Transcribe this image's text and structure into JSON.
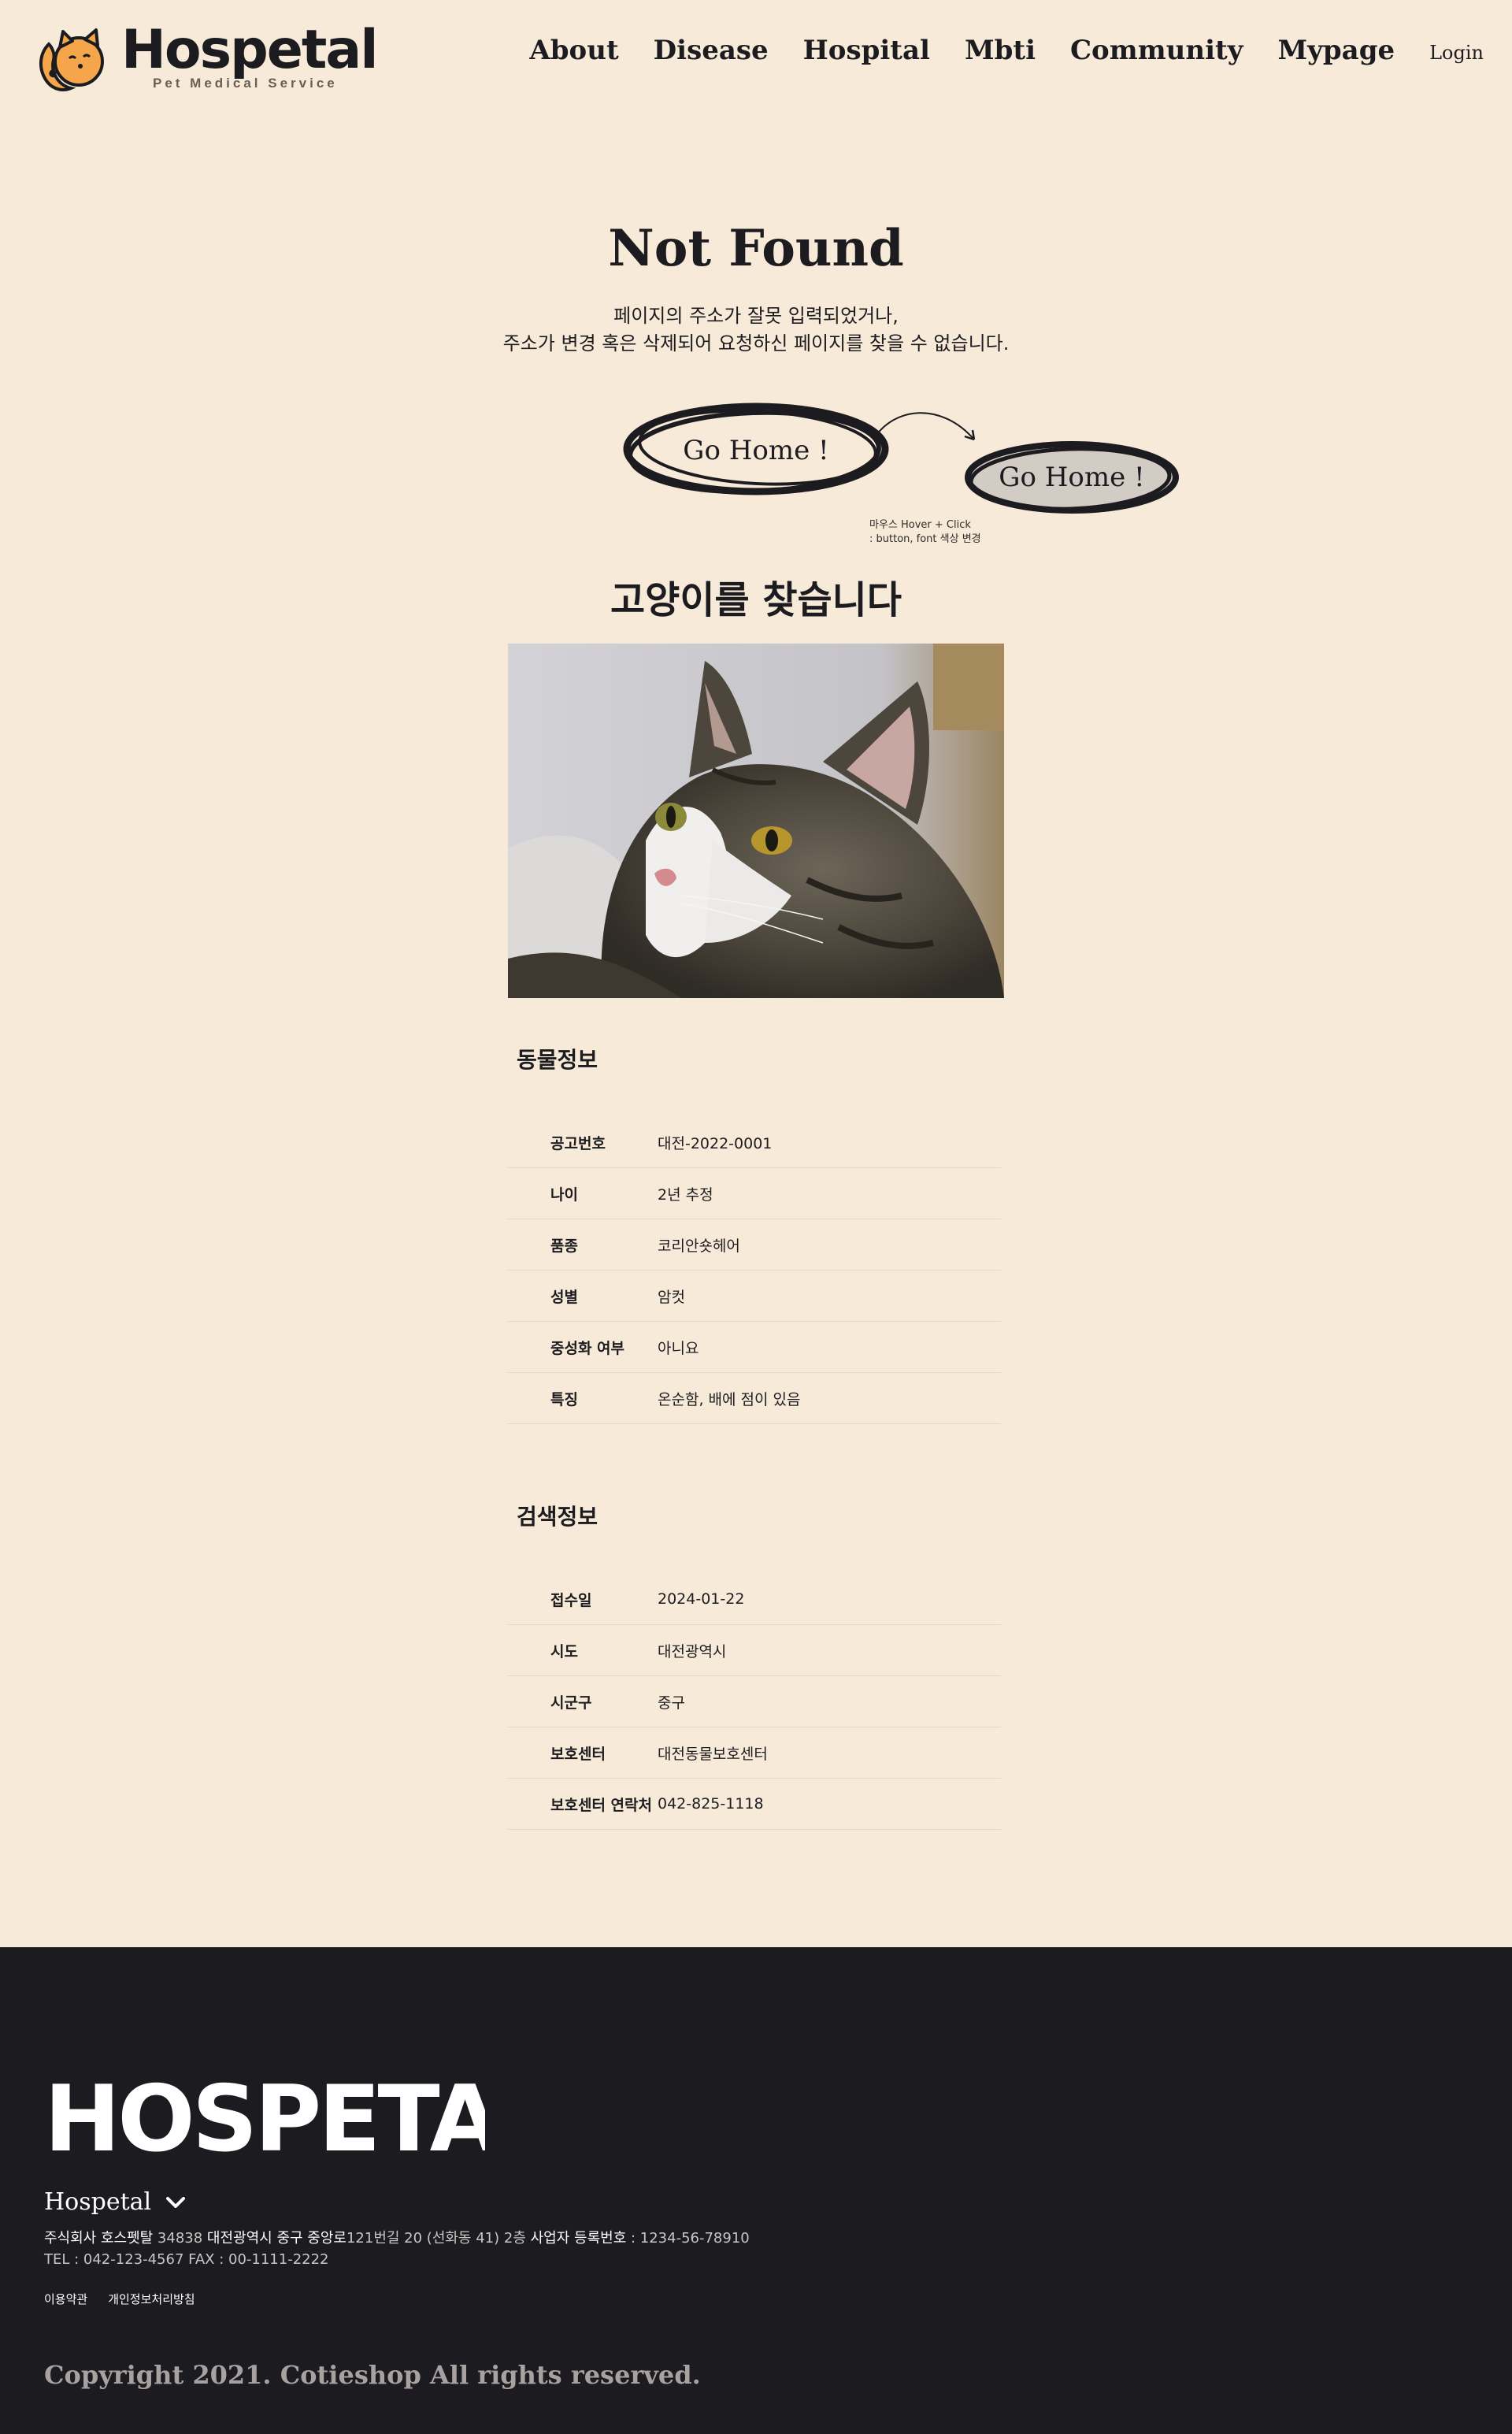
{
  "header": {
    "logo_text": "Hospetal",
    "logo_sub": "Pet Medical Service",
    "nav": [
      "About",
      "Disease",
      "Hospital",
      "Mbti",
      "Community",
      "Mypage"
    ],
    "login": "Login"
  },
  "not_found": {
    "title": "Not Found",
    "message_line1": "페이지의 주소가 잘못 입력되었거나,",
    "message_line2": "주소가 변경 혹은 삭제되어 요청하신 페이지를 찾을 수 없습니다.",
    "home_button": "Go Home !",
    "home_button_hover": "Go Home !",
    "hover_note_line1": "마우스 Hover + Click",
    "hover_note_line2": ": button, font 색상 변경"
  },
  "cat": {
    "title": "고양이를 찾습니다",
    "photo": "tabby-cat-photo"
  },
  "animal_info": {
    "title": "동물정보",
    "rows": [
      {
        "key": "공고번호",
        "value": "대전-2022-0001"
      },
      {
        "key": "나이",
        "value": "2년 추정"
      },
      {
        "key": "품종",
        "value": "코리안숏헤어"
      },
      {
        "key": "성별",
        "value": "암컷"
      },
      {
        "key": "중성화 여부",
        "value": "아니요"
      },
      {
        "key": "특징",
        "value": "온순함, 배에 점이 있음"
      }
    ]
  },
  "search_info": {
    "title": "검색정보",
    "rows": [
      {
        "key": "접수일",
        "value": "2024-01-22"
      },
      {
        "key": "시도",
        "value": "대전광역시"
      },
      {
        "key": "시군구",
        "value": "중구"
      },
      {
        "key": "보호센터",
        "value": "대전동물보호센터"
      },
      {
        "key": "보호센터 연락처",
        "value": "042-825-1118"
      }
    ]
  },
  "footer": {
    "logo_text": "HOSPETAL",
    "brand": "Hospetal",
    "address_label1": "주식회사 호스펫탈",
    "address_value1": " 34838 ",
    "address_label2": "대전광역시 중구 중앙로",
    "address_value2": "121번길 20 (선화동 41) 2층  ",
    "address_label3": "사업자 등록번호",
    "address_value3": " : 1234-56-78910",
    "contact": "TEL : 042-123-4567 FAX : 00-1111-2222",
    "links": [
      "이용약관",
      "개인정보처리방침"
    ],
    "copyright": "Copyright 2021. Cotieshop All rights reserved."
  },
  "colors": {
    "background": "#f8ead8",
    "text": "#1c1b20",
    "footer": "#1c1b20",
    "hover_button_fill": "#d2ccc4",
    "logo_orange": "#f5a64a"
  }
}
